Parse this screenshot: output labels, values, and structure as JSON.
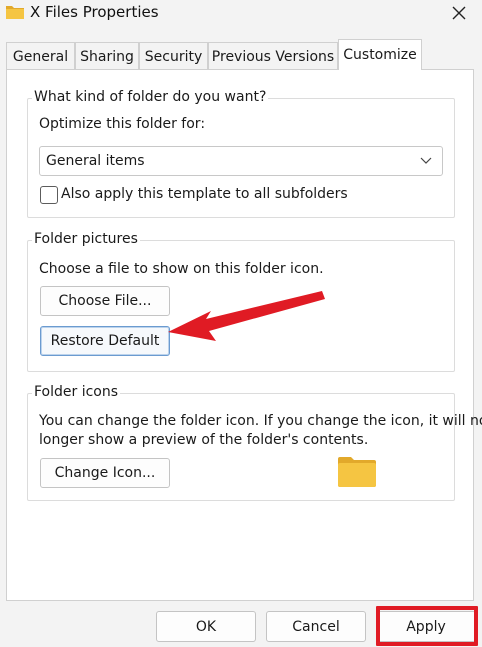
{
  "window": {
    "title": "X Files Properties",
    "close_icon": "close-icon",
    "folder_icon": "folder-icon"
  },
  "tabs": [
    {
      "label": "General",
      "active": false
    },
    {
      "label": "Sharing",
      "active": false
    },
    {
      "label": "Security",
      "active": false
    },
    {
      "label": "Previous Versions",
      "active": false
    },
    {
      "label": "Customize",
      "active": true
    }
  ],
  "folder_type": {
    "legend": "What kind of folder do you want?",
    "optimize_label": "Optimize this folder for:",
    "selected_option": "General items",
    "apply_subfolders_label": "Also apply this template to all subfolders",
    "apply_subfolders_checked": false
  },
  "folder_pictures": {
    "legend": "Folder pictures",
    "description": "Choose a file to show on this folder icon.",
    "choose_file_label": "Choose File...",
    "restore_default_label": "Restore Default"
  },
  "folder_icons": {
    "legend": "Folder icons",
    "description_line1": "You can change the folder icon. If you change the icon, it will no",
    "description_line2": "longer show a preview of the folder's contents.",
    "change_icon_label": "Change Icon..."
  },
  "footer": {
    "ok_label": "OK",
    "cancel_label": "Cancel",
    "apply_label": "Apply"
  },
  "annotations": {
    "arrow_color": "#e01b24",
    "highlight_color": "#e01b24"
  },
  "colors": {
    "folder_yellow": "#f5c542",
    "folder_yellow_dark": "#e2a92b",
    "focus_blue": "#6b9bd0"
  }
}
